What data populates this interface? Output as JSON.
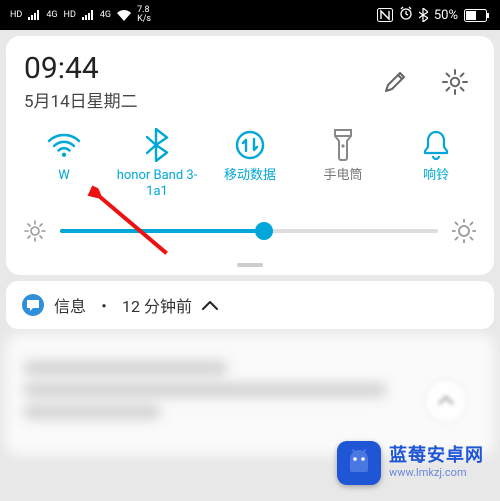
{
  "status": {
    "hd1": "HD",
    "net1": "4G",
    "hd2": "HD",
    "net2": "4G",
    "speed_top": "7.8",
    "speed_bot": "K/s",
    "nfc_label": "N",
    "bt_on": true,
    "battery_pct": "50%"
  },
  "clock": {
    "time": "09:44",
    "date": "5月14日星期二"
  },
  "qs": {
    "wifi": {
      "label": "W",
      "on": true
    },
    "bt": {
      "label": "honor Band 3-1a1",
      "on": true
    },
    "data": {
      "label": "移动数据",
      "on": true
    },
    "torch": {
      "label": "手电筒",
      "on": false
    },
    "ring": {
      "label": "响铃",
      "on": true
    }
  },
  "brightness": {
    "percent": 54
  },
  "notif": {
    "app": "信息",
    "sep": "・",
    "age": "12 分钟前"
  },
  "watermark": {
    "title": "蓝莓安卓网",
    "url": "www.lmkzj.com"
  }
}
